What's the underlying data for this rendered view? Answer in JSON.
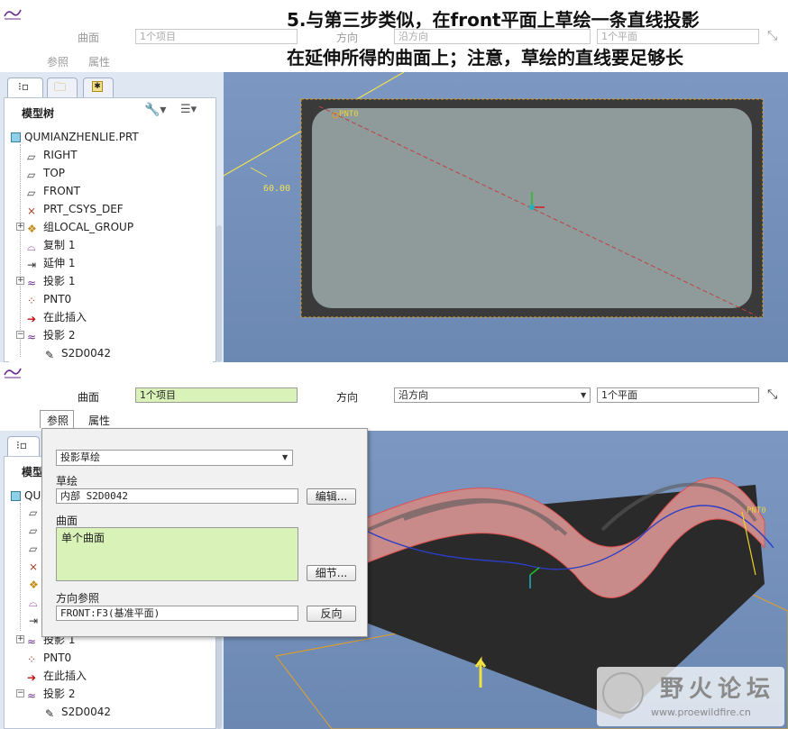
{
  "caption": {
    "line1": "5.与第三步类似，在front平面上草绘一条直线投影",
    "line2": "在延伸所得的曲面上；注意，草绘的直线要足够长"
  },
  "top": {
    "dashboard": {
      "surface_label": "曲面",
      "surface_value": "1个项目",
      "direction_label": "方向",
      "direction_value": "沿方向",
      "plane_value": "1个平面",
      "tab_refs": "参照",
      "tab_props": "属性"
    },
    "tree": {
      "title": "模型树",
      "items": [
        "QUMIANZHENLIE.PRT",
        "RIGHT",
        "TOP",
        "FRONT",
        "PRT_CSYS_DEF",
        "组LOCAL_GROUP",
        "复制 1",
        "延伸 1",
        "投影 1",
        "PNT0",
        "在此插入",
        "投影 2",
        "S2D0042"
      ]
    },
    "viewport": {
      "point_label": "PNT0",
      "dimension": "60.00"
    }
  },
  "bottom": {
    "dashboard": {
      "surface_label": "曲面",
      "surface_value": "1个项目",
      "direction_label": "方向",
      "direction_value": "沿方向",
      "plane_value": "1个平面",
      "tab_refs": "参照",
      "tab_props": "属性"
    },
    "refs_panel": {
      "type_value": "投影草绘",
      "sketch_label": "草绘",
      "sketch_value": "内部 S2D0042",
      "edit_button": "编辑...",
      "surface_label": "曲面",
      "surface_value": "单个曲面",
      "details_button": "细节...",
      "dirref_label": "方向参照",
      "dirref_value": "FRONT:F3(基准平面)",
      "flip_button": "反向"
    },
    "tree": {
      "title": "模型",
      "first_item": "QU",
      "items": [
        "投影 1",
        "PNT0",
        "在此插入",
        "投影 2",
        "S2D0042"
      ]
    },
    "viewport": {
      "point_label": "PNT0"
    },
    "watermark": {
      "text": "野火论坛",
      "url": "www.proewildfire.cn"
    }
  },
  "colors": {
    "viewport_bg": "#6f8db8",
    "sketch_plane": "#8f9a9a",
    "highlight_green": "#d9f2b8",
    "surface_pink": "#c98a8a",
    "projection_line": "#2b3fc4"
  }
}
